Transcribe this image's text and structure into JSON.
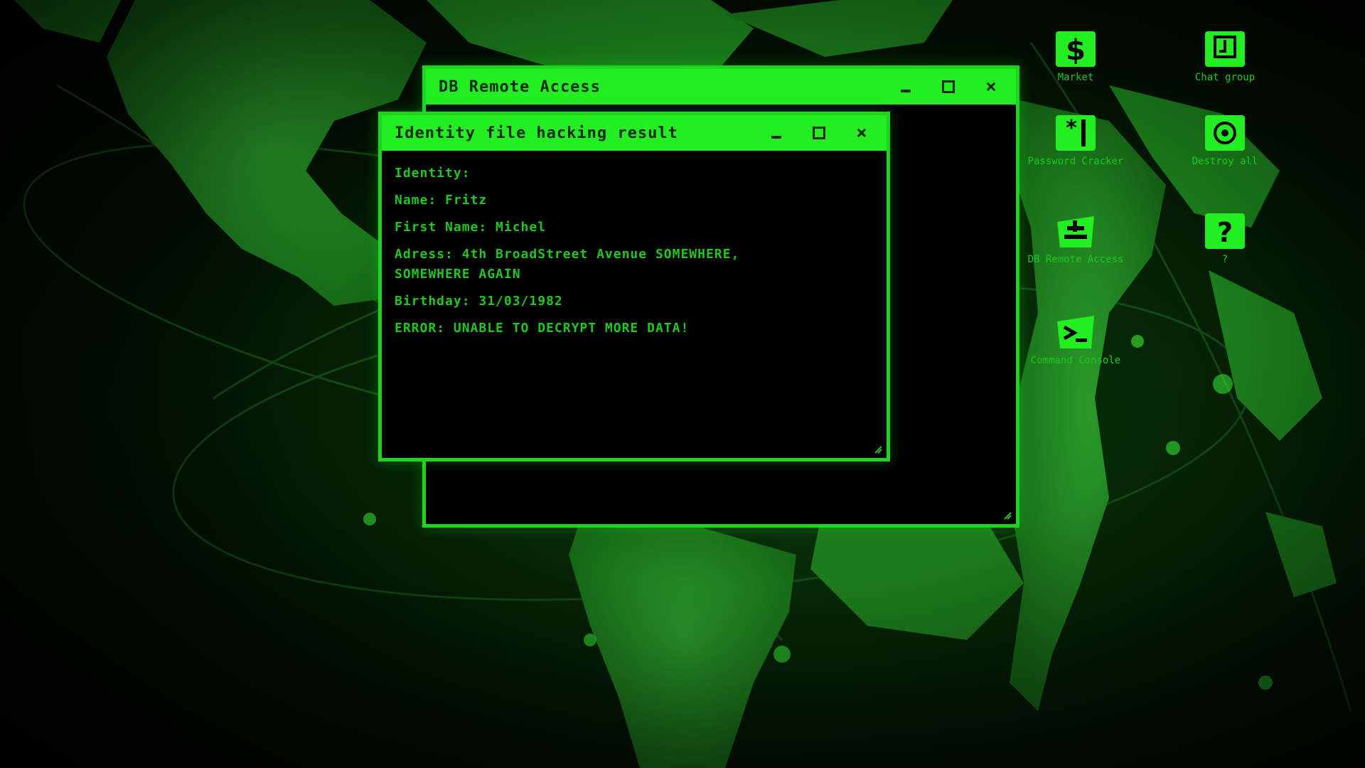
{
  "theme": {
    "accent": "#22ee22",
    "text": "#1ec81e",
    "window_bg": "#000000",
    "title_text": "#0b2a0b"
  },
  "windows": {
    "back": {
      "title": "DB Remote Access",
      "buttons": {
        "minimize": "_",
        "maximize": "□",
        "close": "×"
      }
    },
    "front": {
      "title": "Identity file hacking result",
      "buttons": {
        "minimize": "_",
        "maximize": "□",
        "close": "×"
      },
      "lines": [
        "Identity:",
        "Name: Fritz",
        "First Name: Michel",
        "Adress: 4th BroadStreet Avenue SOMEWHERE,",
        "SOMEWHERE AGAIN",
        "Birthday: 31/03/1982",
        "ERROR: UNABLE TO DECRYPT MORE DATA!"
      ]
    }
  },
  "desktop_icons": [
    {
      "id": "market",
      "label": "Market",
      "icon": "dollar-icon"
    },
    {
      "id": "chat",
      "label": "Chat group",
      "icon": "chat-icon"
    },
    {
      "id": "password",
      "label": "Password Cracker",
      "icon": "password-icon"
    },
    {
      "id": "destroy",
      "label": "Destroy all",
      "icon": "destroy-icon"
    },
    {
      "id": "db",
      "label": "DB Remote Access",
      "icon": "database-icon"
    },
    {
      "id": "help",
      "label": "?",
      "icon": "question-icon"
    },
    {
      "id": "console",
      "label": "Command Console",
      "icon": "console-icon"
    }
  ]
}
